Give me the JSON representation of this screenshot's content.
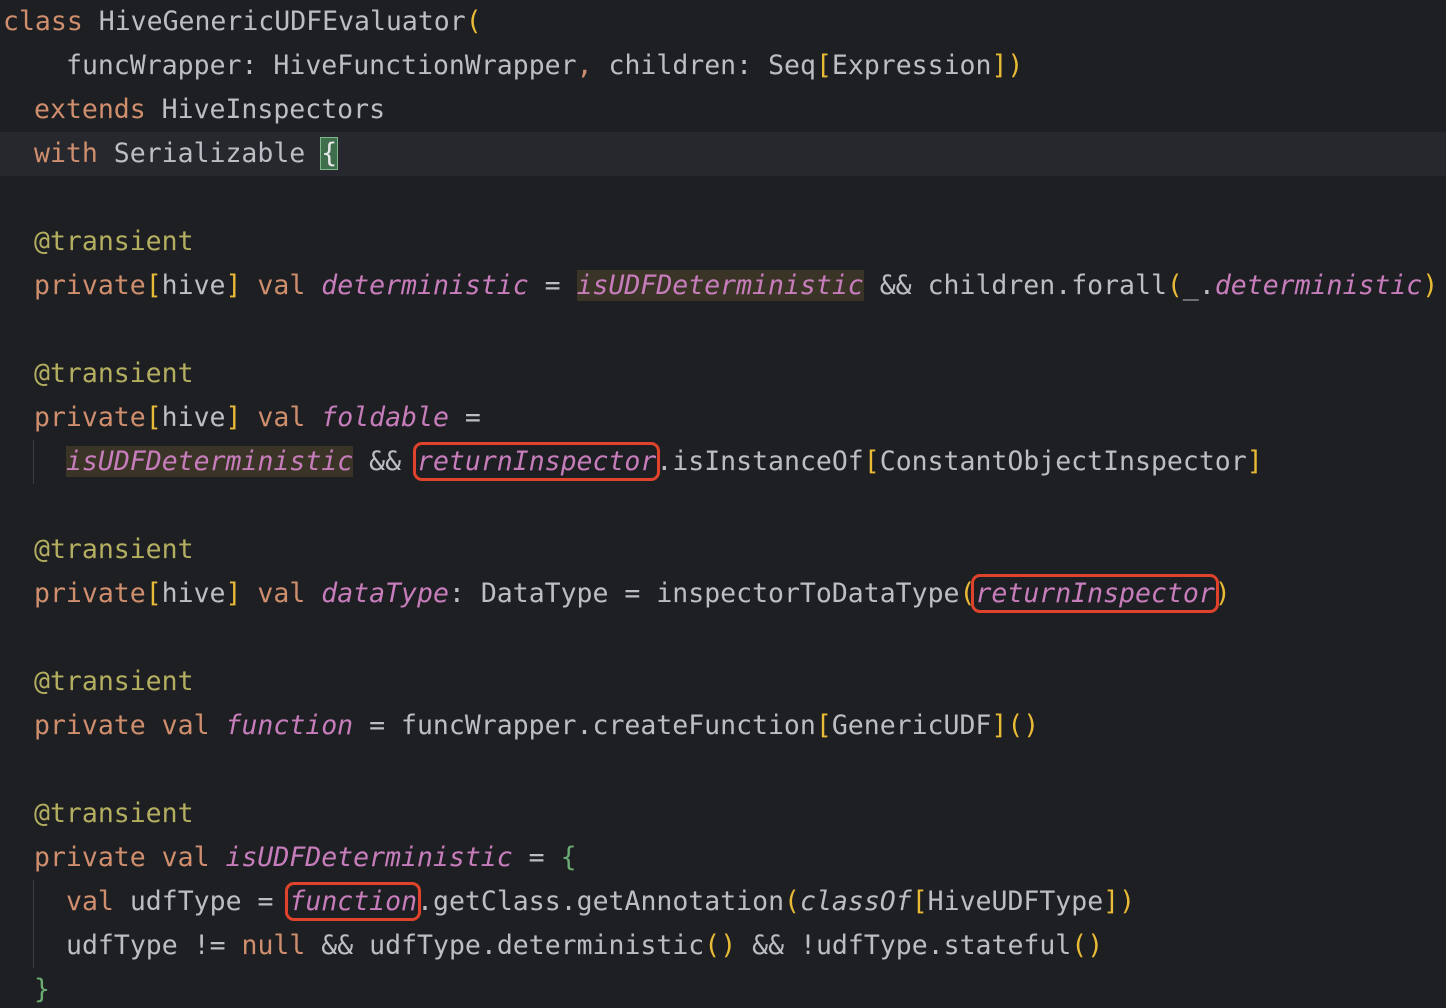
{
  "code": {
    "class_kw": "class",
    "class_name": "HiveGenericUDFEvaluator",
    "open_paren": "(",
    "param_func_wrapper": "funcWrapper",
    "colon_sp": ": ",
    "type_hive_function_wrapper": "HiveFunctionWrapper",
    "comma": ",",
    "param_children": "children",
    "type_seq": "Seq",
    "open_bracket": "[",
    "type_expression": "Expression",
    "close_bracket": "]",
    "close_paren": ")",
    "extends_kw": "extends",
    "type_hive_inspectors": "HiveInspectors",
    "with_kw": "with",
    "type_serializable": "Serializable",
    "open_brace": "{",
    "close_brace": "}",
    "annotation": "@transient",
    "private_kw": "private",
    "scope_hive": "hive",
    "val_kw": "val",
    "eq": " = ",
    "and_op": " && ",
    "dot": ".",
    "field_deterministic": "deterministic",
    "field_is_udf_deterministic": "isUDFDeterministic",
    "children": "children",
    "method_forall": "forall",
    "underscore": "_",
    "field_foldable": "foldable",
    "eq_trailing": " =",
    "field_return_inspector": "returnInspector",
    "method_is_instance_of": "isInstanceOf",
    "type_constant_object_inspector": "ConstantObjectInspector",
    "field_data_type": "dataType",
    "type_data_type": "DataType",
    "method_inspector_to_data_type": "inspectorToDataType",
    "field_function": "function",
    "func_wrapper": "funcWrapper",
    "method_create_function": "createFunction",
    "type_generic_udf": "GenericUDF",
    "empty_parens": "()",
    "local_udf_type": "udfType",
    "method_get_class": "getClass",
    "method_get_annotation": "getAnnotation",
    "method_class_of": "classOf",
    "type_hive_udf_type": "HiveUDFType",
    "ne_op": " != ",
    "null_kw": "null",
    "method_deterministic": "deterministic",
    "bang": "!",
    "method_stateful": "stateful"
  },
  "colors": {
    "background": "#1e1f22",
    "current_line": "#26282e",
    "keyword": "#cf8e6d",
    "identifier": "#bcbec4",
    "field": "#c77dbb",
    "annotation": "#b3ae60",
    "bracket_yellow": "#e8ba36",
    "bracket_green": "#6aab73",
    "usage_highlight": "#3a3427",
    "markup_box": "#e0432b"
  }
}
